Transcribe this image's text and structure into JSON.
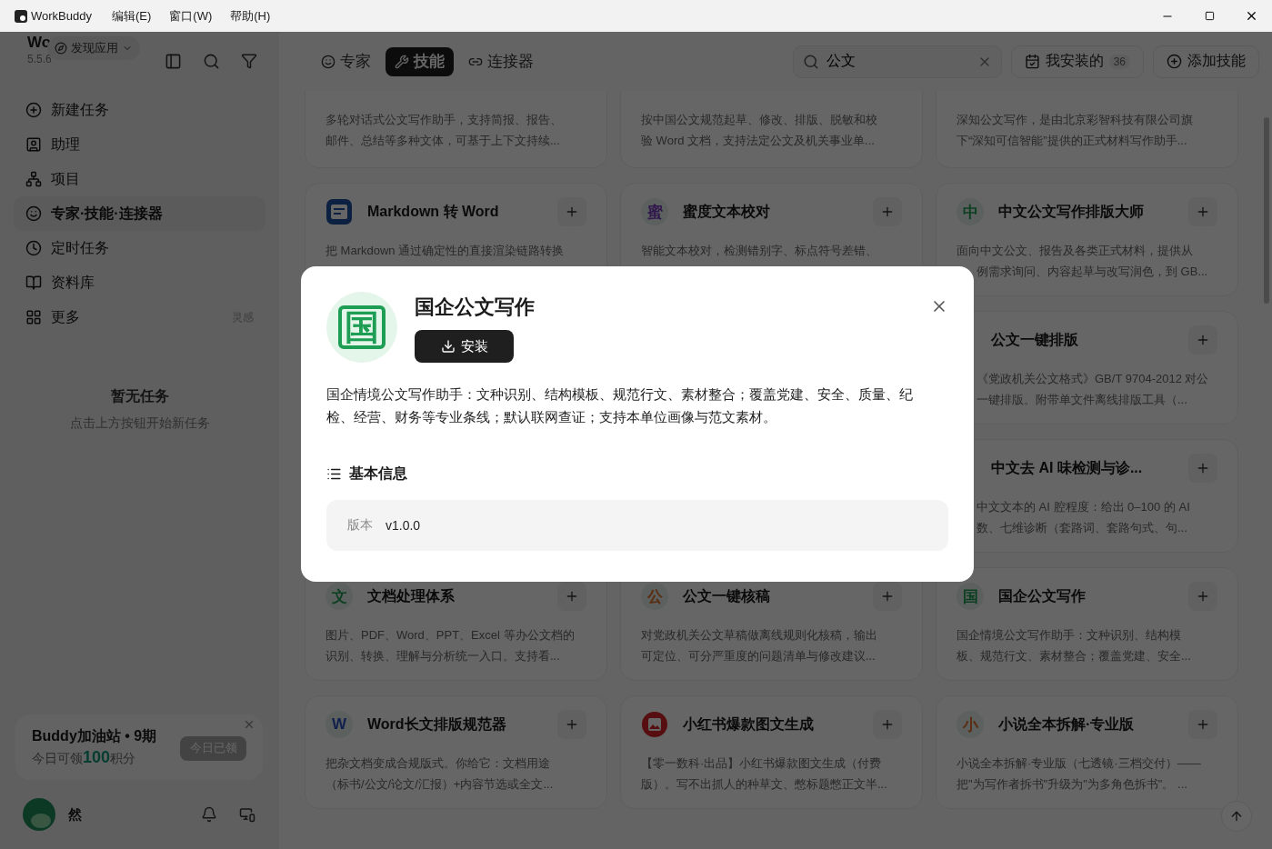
{
  "titlebar": {
    "app": "WorkBuddy",
    "menus": [
      "编辑(E)",
      "窗口(W)",
      "帮助(H)"
    ]
  },
  "sidebar": {
    "app_name": "Wo",
    "version": "5.5.6",
    "discover": "发现应用",
    "nav": [
      {
        "label": "新建任务",
        "selected": false
      },
      {
        "label": "助理",
        "selected": false
      },
      {
        "label": "项目",
        "selected": false
      },
      {
        "label": "专家·技能·连接器",
        "selected": true
      },
      {
        "label": "定时任务",
        "selected": false
      },
      {
        "label": "资料库",
        "selected": false
      },
      {
        "label": "更多",
        "selected": false,
        "hint": "灵感"
      }
    ],
    "empty_title": "暂无任务",
    "empty_hint": "点击上方按钮开始新任务",
    "promo": {
      "title": "Buddy加油站 • 9期",
      "before": "今日可领",
      "amount": "100",
      "after": "积分",
      "button": "今日已领",
      "claimed": true
    },
    "user": {
      "name": "然"
    }
  },
  "main": {
    "tabs": [
      {
        "label": "专家",
        "selected": false
      },
      {
        "label": "技能",
        "selected": true
      },
      {
        "label": "连接器",
        "selected": false
      }
    ],
    "search": {
      "value": "公文"
    },
    "installed": {
      "label": "我安装的",
      "count": "36"
    },
    "add": "添加技能",
    "rows": [
      {
        "cards": [
          {
            "lines": [
              {
                "text": "多轮对话式公文写作助手，支持简报、报告、",
                "covered": false
              },
              {
                "text": "邮件、总结等多种文体，可基于上下文持续...",
                "covered": false
              }
            ]
          },
          {
            "lines": [
              {
                "text": "按中国公文规范起草、修改、排版、脱敏和校",
                "covered": false
              },
              {
                "text": "验 Word 文档，支持法定公文及机关事业单...",
                "covered": false
              }
            ]
          },
          {
            "lines": [
              {
                "text": "深知公文写作，是由北京彩智科技有限公司旗",
                "covered": false
              },
              {
                "text": "下“深知可信智能”提供的正式材料写作助手...",
                "covered": false
              }
            ]
          }
        ]
      },
      {
        "cards": [
          {
            "title": "Markdown 转 Word",
            "icon": {
              "kind": "doc",
              "color": "#0c2041"
            },
            "covered": false,
            "lines": [
              {
                "text": "把 Markdown 通过确定性的直接渲染链路转换",
                "covered": false
              }
            ]
          },
          {
            "title": "蜜度文本校对",
            "icon": {
              "kind": "char",
              "text": "蜜",
              "color": "#31194e"
            },
            "covered": false,
            "lines": [
              {
                "text": "智能文本校对，检测错别字、标点符号差错、",
                "covered": false
              }
            ]
          },
          {
            "title": "中文公文写作排版大师",
            "icon": {
              "kind": "char",
              "text": "中",
              "color": "#0c3f22"
            },
            "covered": false,
            "lines": [
              {
                "text": "面向中文公文、报告及各类正式材料，提供从",
                "covered": false
              },
              {
                "text": "例需求询问、内容起草与改写润色，到 GB...",
                "covered": true
              }
            ]
          }
        ]
      },
      {
        "cards": [
          {
            "title": "公文一键排版",
            "covered": true,
            "lines": [
              {
                "text": "《党政机关公文格式》GB/T 9704-2012 对公",
                "covered": true
              },
              {
                "text": "一键排版。附带单文件离线排版工具（...",
                "covered": true
              }
            ]
          }
        ]
      },
      {
        "cards": [
          {
            "title": "中文去 AI 味检测与诊...",
            "covered": true,
            "lines": [
              {
                "text": "中文文本的 AI 腔程度：给出 0–100 的 AI",
                "covered": true
              },
              {
                "text": "数、七维诊断（套路词、套路句式、句...",
                "covered": true
              }
            ]
          }
        ]
      },
      {
        "cards": [
          {
            "title": "文档处理体系",
            "icon": {
              "kind": "char",
              "text": "文",
              "color": "#0c3f22"
            },
            "covered": false,
            "lines": [
              {
                "text": "图片、PDF、Word、PPT、Excel 等办公文档的",
                "covered": false
              },
              {
                "text": "识别、转换、理解与分析统一入口。支持看...",
                "covered": false
              }
            ]
          },
          {
            "title": "公文一键核稿",
            "icon": {
              "kind": "char",
              "text": "公",
              "color": "#5a2d11"
            },
            "covered": false,
            "lines": [
              {
                "text": "对党政机关公文草稿做离线规则化核稿，输出",
                "covered": false
              },
              {
                "text": "可定位、可分严重度的问题清单与修改建议...",
                "covered": false
              }
            ]
          },
          {
            "title": "国企公文写作",
            "icon": {
              "kind": "char",
              "text": "国",
              "color": "#0c3f22"
            },
            "covered": false,
            "lines": [
              {
                "text": "国企情境公文写作助手：文种识别、结构模",
                "covered": false
              },
              {
                "text": "板、规范行文、素材整合；覆盖党建、安全...",
                "covered": false
              }
            ]
          }
        ]
      },
      {
        "cards": [
          {
            "title": "Word长文排版规范器",
            "icon": {
              "kind": "char",
              "text": "W",
              "color": "#11204d"
            },
            "covered": false,
            "lines": [
              {
                "text": "把杂文档变成合规版式。你给它：文档用途",
                "covered": false
              },
              {
                "text": "（标书/公文/论文/汇报）+内容节选或全文...",
                "covered": false
              }
            ]
          },
          {
            "title": "小红书爆款图文生成",
            "icon": {
              "kind": "photo",
              "color": "#560e11"
            },
            "covered": false,
            "lines": [
              {
                "text": "【零一数科·出品】小红书爆款图文生成（付费",
                "covered": false
              },
              {
                "text": "版）。写不出抓人的种草文、憋标题憋正文半...",
                "covered": false
              }
            ]
          },
          {
            "title": "小说全本拆解·专业版",
            "icon": {
              "kind": "char",
              "text": "小",
              "color": "#5a2d11"
            },
            "covered": false,
            "lines": [
              {
                "text": "小说全本拆解·专业版（七透镜·三档交付）——",
                "covered": false
              },
              {
                "text": "把\"为写作者拆书\"升级为\"为多角色拆书\"。 ...",
                "covered": false
              }
            ]
          }
        ]
      }
    ]
  },
  "dialog": {
    "icon_char": "国",
    "title": "国企公文写作",
    "install": "安装",
    "description": "国企情境公文写作助手：文种识别、结构模板、规范行文、素材整合；覆盖党建、安全、质量、纪检、经营、财务等专业条线；默认联网查证；支持本单位画像与范文素材。",
    "section": "基本信息",
    "info": [
      {
        "label": "版本",
        "value": "v1.0.0"
      }
    ]
  }
}
